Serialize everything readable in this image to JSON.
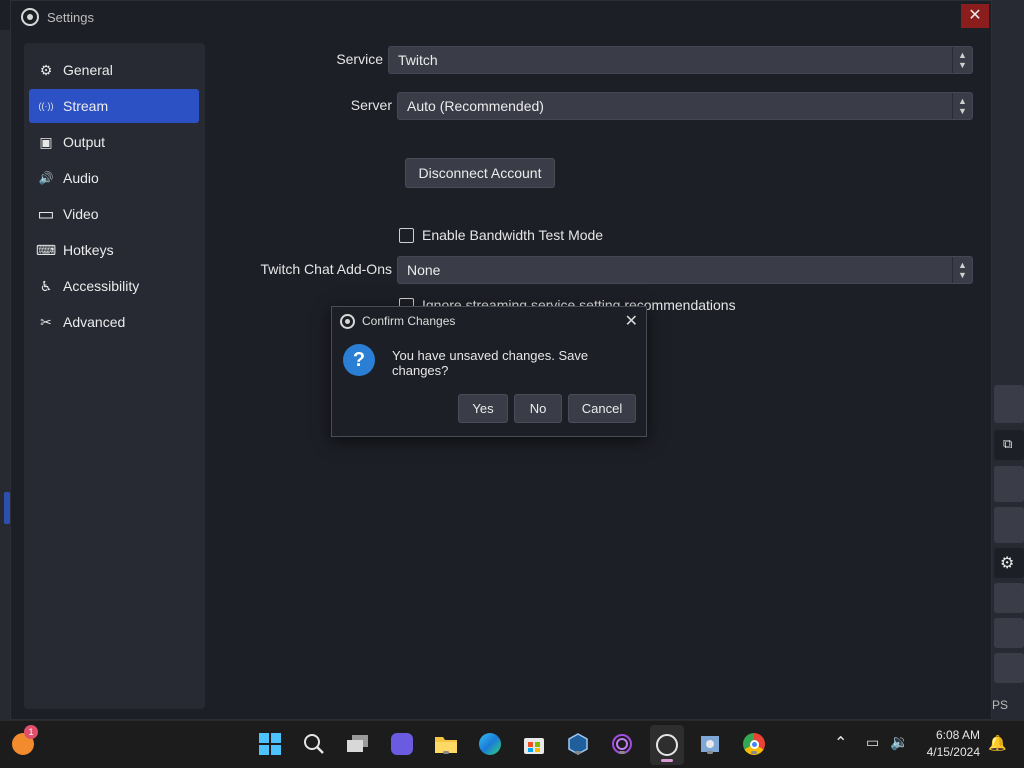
{
  "window": {
    "title": "Settings",
    "close_glyph": "✕"
  },
  "sidebar": {
    "items": [
      {
        "label": "General",
        "icon": "gear-icon",
        "glyph": "⚙"
      },
      {
        "label": "Stream",
        "icon": "antenna-icon",
        "glyph": "((·))"
      },
      {
        "label": "Output",
        "icon": "output-icon",
        "glyph": "▣"
      },
      {
        "label": "Audio",
        "icon": "speaker-icon",
        "glyph": "🔊"
      },
      {
        "label": "Video",
        "icon": "monitor-icon",
        "glyph": "▭"
      },
      {
        "label": "Hotkeys",
        "icon": "keyboard-icon",
        "glyph": "⌨"
      },
      {
        "label": "Accessibility",
        "icon": "accessibility-icon",
        "glyph": "♿"
      },
      {
        "label": "Advanced",
        "icon": "tools-icon",
        "glyph": "✂"
      }
    ],
    "active_index": 1
  },
  "stream": {
    "service_label": "Service",
    "service_value": "Twitch",
    "server_label": "Server",
    "server_value": "Auto (Recommended)",
    "disconnect_label": "Disconnect Account",
    "bandwidth_label": "Enable Bandwidth Test Mode",
    "chat_addons_label": "Twitch Chat Add-Ons",
    "chat_addons_value": "None",
    "ignore_label": "Ignore streaming service setting recommendations"
  },
  "dialog": {
    "title": "Confirm Changes",
    "message": "You have unsaved changes. Save changes?",
    "yes_label": "Yes",
    "no_label": "No",
    "cancel_label": "Cancel"
  },
  "background": {
    "fps_fragment": "PS"
  },
  "taskbar": {
    "notification_count": "1",
    "time": "6:08 AM",
    "date": "4/15/2024"
  },
  "colors": {
    "accent": "#2c51c4",
    "window_bg": "#1d1f26",
    "panel_bg": "#272a33",
    "control_bg": "#3a3d47"
  }
}
